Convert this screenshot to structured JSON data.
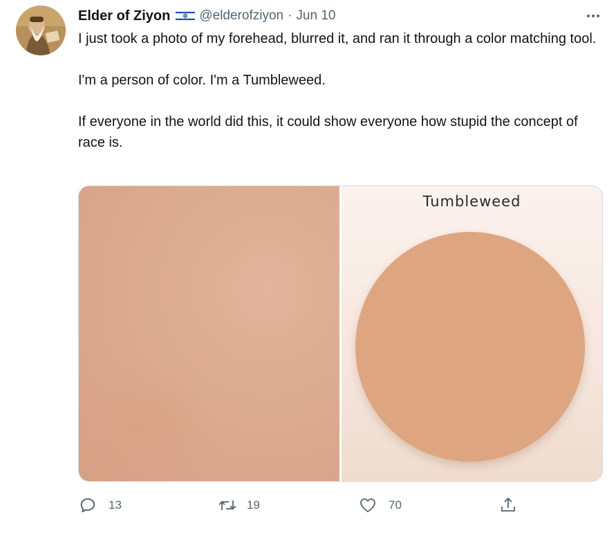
{
  "tweet": {
    "author_name": "Elder of Ziyon",
    "author_handle": "@elderofziyon",
    "separator": "·",
    "date": "Jun 10",
    "flag_icon": "israel-flag-icon",
    "paragraphs": [
      "I just took a photo of my forehead, blurred it, and ran it through a color matching tool.",
      "I'm a person of color. I'm a Tumbleweed.",
      "If everyone in the world did this, it could show everyone how stupid the concept of race is."
    ]
  },
  "media": {
    "swatch_label": "Tumbleweed",
    "swatch_color": "#dea680",
    "skin_photo_color": "#dcab8f"
  },
  "actions": {
    "reply_count": "13",
    "retweet_count": "19",
    "like_count": "70",
    "icons": [
      "reply-icon",
      "retweet-icon",
      "like-icon",
      "share-icon"
    ]
  },
  "colors": {
    "text_primary": "#0f1419",
    "text_secondary": "#536471",
    "border": "#cfd9de"
  }
}
